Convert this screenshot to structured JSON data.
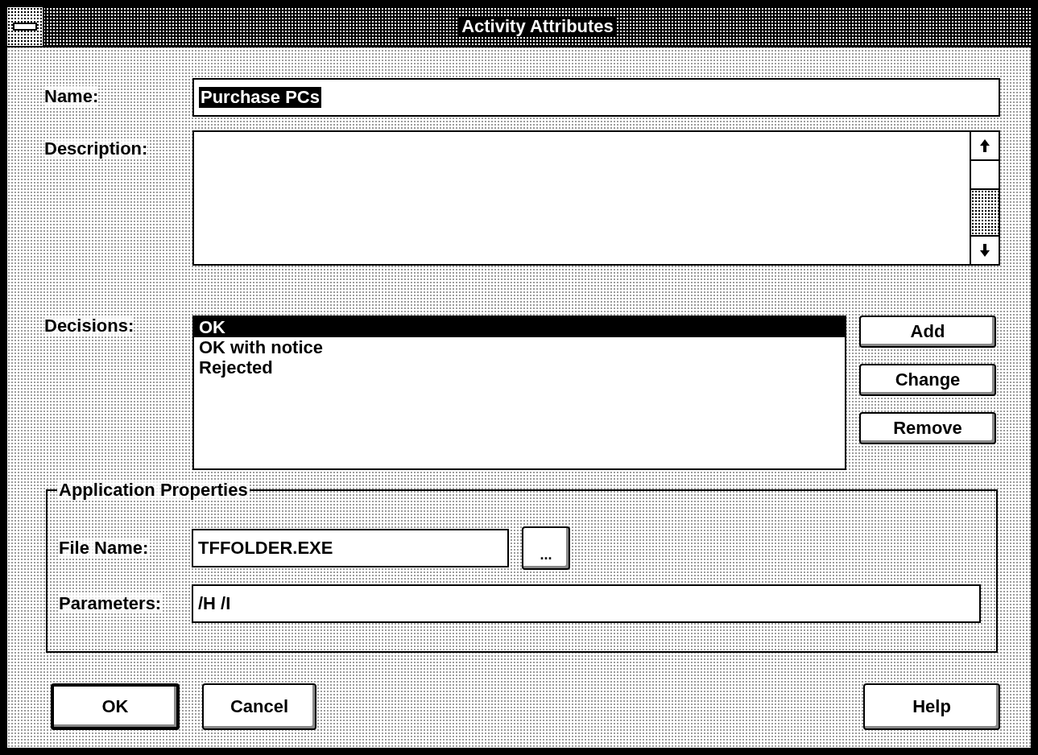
{
  "window": {
    "title": "Activity Attributes"
  },
  "name": {
    "label": "Name:",
    "value": "Purchase PCs",
    "value_selected": true
  },
  "description": {
    "label": "Description:"
  },
  "decisions": {
    "label": "Decisions:",
    "items": [
      {
        "label": "OK",
        "selected": true
      },
      {
        "label": "OK with notice",
        "selected": false
      },
      {
        "label": "Rejected",
        "selected": false
      }
    ]
  },
  "decision_buttons": [
    "Add",
    "Change",
    "Remove"
  ],
  "application_properties": {
    "title": "Application Properties",
    "file_name": {
      "label": "File Name:",
      "value": "TFFOLDER.EXE"
    },
    "browse_button": "...",
    "parameters": {
      "label": "Parameters:",
      "value": "/H /I"
    }
  },
  "buttons": [
    {
      "label": "OK",
      "default": true
    },
    {
      "label": "Cancel",
      "default": false
    },
    {
      "label": "Help",
      "default": false
    }
  ]
}
